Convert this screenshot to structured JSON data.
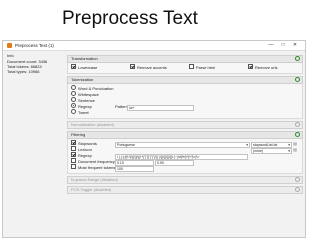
{
  "slide": {
    "title": "Preprocess Text"
  },
  "window": {
    "title": "Preprocess Text (1)",
    "controls": [
      "—",
      "□",
      "✕"
    ]
  },
  "info": {
    "header": "Info",
    "document_count": "Document count: 3436",
    "total_tokens": "Total tokens: 66824",
    "total_types": "Total types: 10966"
  },
  "transformation": {
    "header": "Transformation",
    "options": [
      {
        "label": "Lowercase",
        "checked": true
      },
      {
        "label": "Remove accents",
        "checked": true
      },
      {
        "label": "Parse html",
        "checked": false
      },
      {
        "label": "Remove urls",
        "checked": true
      }
    ]
  },
  "tokenization": {
    "header": "Tokenization",
    "options": [
      {
        "label": "Word & Punctuation",
        "selected": false
      },
      {
        "label": "Whitespace",
        "selected": false
      },
      {
        "label": "Sentence",
        "selected": false
      },
      {
        "label": "Regexp",
        "selected": true
      },
      {
        "label": "Tweet",
        "selected": false
      }
    ],
    "pattern_label": "Pattern:",
    "pattern_value": "\\w+"
  },
  "normalization": {
    "header": "Normalization (disabled)"
  },
  "filtering": {
    "header": "Filtering",
    "stopwords": {
      "label": "Stopwords",
      "checked": true,
      "language": "Portuguese",
      "file": "stopwordList.txt"
    },
    "lexicon": {
      "label": "Lexicon",
      "checked": false,
      "file": "(none)"
    },
    "regexp": {
      "label": "Regexp",
      "checked": true,
      "value": "\\.|,|:|;|!|\\?|\\(|\\)|\\||\\+|'|\"|'|'|\"|\"|\\||`|\\}|\\{|\\[|\\]|\\-|~|\\d|%|\\^|\\*|\\<|\\>"
    },
    "doc_freq": {
      "label": "Document frequency",
      "checked": false,
      "min": "0.10",
      "max": "0.90"
    },
    "most_frequent": {
      "label": "Most frequent tokens",
      "checked": false,
      "value": "100"
    }
  },
  "ngrams": {
    "header": "N-grams Range (disabled)"
  },
  "pos": {
    "header": "POS Tagger (disabled)"
  }
}
